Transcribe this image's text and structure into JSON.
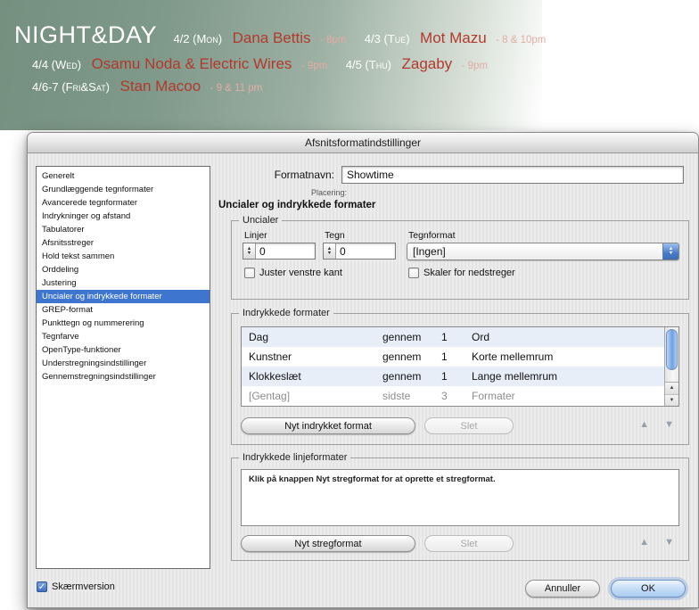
{
  "banner": {
    "title": "NIGHT&DAY",
    "line1": {
      "date1": "4/2 (Mon)",
      "name1": "Dana Bettis",
      "time1": "- 8pm",
      "date2": "4/3 (Tue)",
      "name2": "Mot Mazu",
      "time2": "- 8 & 10pm"
    },
    "line2": {
      "date1": "4/4 (Wed)",
      "name1": "Osamu Noda & Electric Wires",
      "time1": "- 9pm",
      "date2": "4/5 (Thu)",
      "name2": "Zagaby",
      "time2": "- 9pm"
    },
    "line3": {
      "date1": "4/6-7 (Fri&Sat)",
      "name1": "Stan Macoo",
      "time1": "- 9 & 11 pm"
    }
  },
  "dialog": {
    "title": "Afsnitsformatindstillinger",
    "sidebar": [
      "Generelt",
      "Grundlæggende tegnformater",
      "Avancerede tegnformater",
      "Indrykninger og afstand",
      "Tabulatorer",
      "Afsnitsstreger",
      "Hold tekst sammen",
      "Orddeling",
      "Justering",
      "Uncialer og indrykkede formater",
      "GREP-format",
      "Punkttegn og nummerering",
      "Tegnfarve",
      "OpenType-funktioner",
      "Understregningsindstillinger",
      "Gennemstregningsindstillinger"
    ],
    "format_name_label": "Formatnavn:",
    "format_name_value": "Showtime",
    "location_label": "Placering:",
    "section_heading": "Uncialer og indrykkede formater",
    "drop_caps": {
      "group_title": "Uncialer",
      "lines_label": "Linjer",
      "lines_value": "0",
      "chars_label": "Tegn",
      "chars_value": "0",
      "char_style_label": "Tegnformat",
      "char_style_value": "[Ingen]",
      "align_left_checkbox": "Juster venstre kant",
      "scale_descenders_checkbox": "Skaler for nedstreger"
    },
    "nested_styles": {
      "group_title": "Indrykkede formater",
      "rows": [
        {
          "name": "Dag",
          "through": "gennem",
          "count": "1",
          "unit": "Ord"
        },
        {
          "name": "Kunstner",
          "through": "gennem",
          "count": "1",
          "unit": "Korte mellemrum"
        },
        {
          "name": "Klokkeslæt",
          "through": "gennem",
          "count": "1",
          "unit": "Lange mellemrum"
        },
        {
          "name": "[Gentag]",
          "through": "sidste",
          "count": "3",
          "unit": "Formater"
        }
      ],
      "new_button": "Nyt indrykket format",
      "delete_button": "Slet"
    },
    "nested_line_styles": {
      "group_title": "Indrykkede linjeformater",
      "empty_message": "Klik på knappen Nyt stregformat for at oprette et stregformat.",
      "new_button": "Nyt stregformat",
      "delete_button": "Slet"
    },
    "preview_checkbox": "Skærmversion",
    "cancel_button": "Annuller",
    "ok_button": "OK"
  },
  "colors": {
    "selection_blue": "#3e75cf",
    "banner_green": "#7d9889",
    "band_name_red": "#b2392b",
    "time_pink": "#e3aca4",
    "aqua_scroll_blue": "#6f9fe0"
  }
}
